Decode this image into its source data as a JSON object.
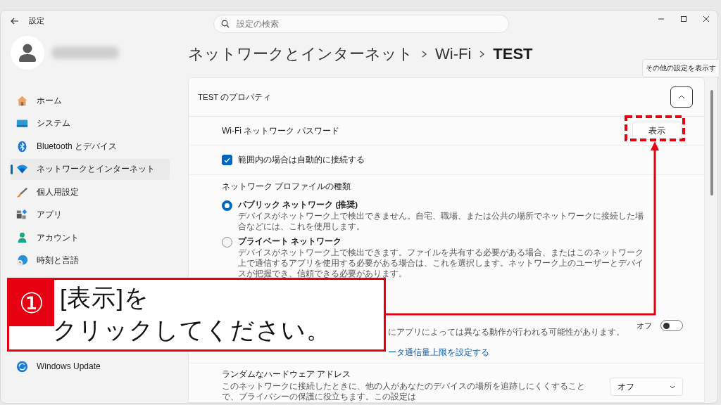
{
  "window": {
    "title": "設定"
  },
  "search": {
    "placeholder": "設定の検索"
  },
  "sidebar": {
    "items": [
      {
        "kind": "home",
        "label": "ホーム",
        "selected": false
      },
      {
        "kind": "system",
        "label": "システム",
        "selected": false
      },
      {
        "kind": "bluetooth",
        "label": "Bluetooth とデバイス",
        "selected": false
      },
      {
        "kind": "network",
        "label": "ネットワークとインターネット",
        "selected": true
      },
      {
        "kind": "personalize",
        "label": "個人用設定",
        "selected": false
      },
      {
        "kind": "apps",
        "label": "アプリ",
        "selected": false
      },
      {
        "kind": "accounts",
        "label": "アカウント",
        "selected": false
      },
      {
        "kind": "time",
        "label": "時刻と言語",
        "selected": false
      },
      {
        "kind": "update",
        "label": "Windows Update",
        "selected": false
      }
    ]
  },
  "breadcrumb": [
    "ネットワークとインターネット",
    "Wi-Fi",
    "TEST"
  ],
  "tooltip": "その他の設定を表示す",
  "properties": {
    "title": "TEST のプロパティ",
    "expanded": true,
    "password": {
      "label": "Wi-Fi ネットワーク パスワード",
      "button": "表示"
    },
    "auto_connect": {
      "label": "範囲内の場合は自動的に接続する",
      "checked": true
    },
    "profile": {
      "heading": "ネットワーク プロファイルの種類",
      "options": [
        {
          "label": "パブリック ネットワーク (推奨)",
          "description": "デバイスがネットワーク上で検出できません。自宅、職場、または公共の場所でネットワークに接続した場合などには、これを使用します。",
          "selected": true
        },
        {
          "label": "プライベート ネットワーク",
          "description": "デバイスがネットワーク上で検出できます。ファイルを共有する必要がある場合、またはこのネットワーク上で通信するアプリを使用する必要がある場合は、これを選択します。ネットワーク上のユーザーとデバイスが把握でき、信頼できる必要があります。",
          "selected": false
        }
      ]
    },
    "metered": {
      "description": "にアプリによっては異なる動作が行われる可能性があります。",
      "state": "オフ",
      "on": false,
      "link": "ータ通信量上限を設定する"
    },
    "random_hw": {
      "label": "ランダムなハードウェア アドレス",
      "description": "このネットワークに接続したときに、他の人があなたのデバイスの場所を追跡しにくくすることで、プライバシーの保護に役立ちます。この設定は",
      "dropdown": "オフ"
    }
  },
  "annotation": {
    "number": "①",
    "lines": [
      "[表示]を",
      "クリックしてください。"
    ]
  }
}
